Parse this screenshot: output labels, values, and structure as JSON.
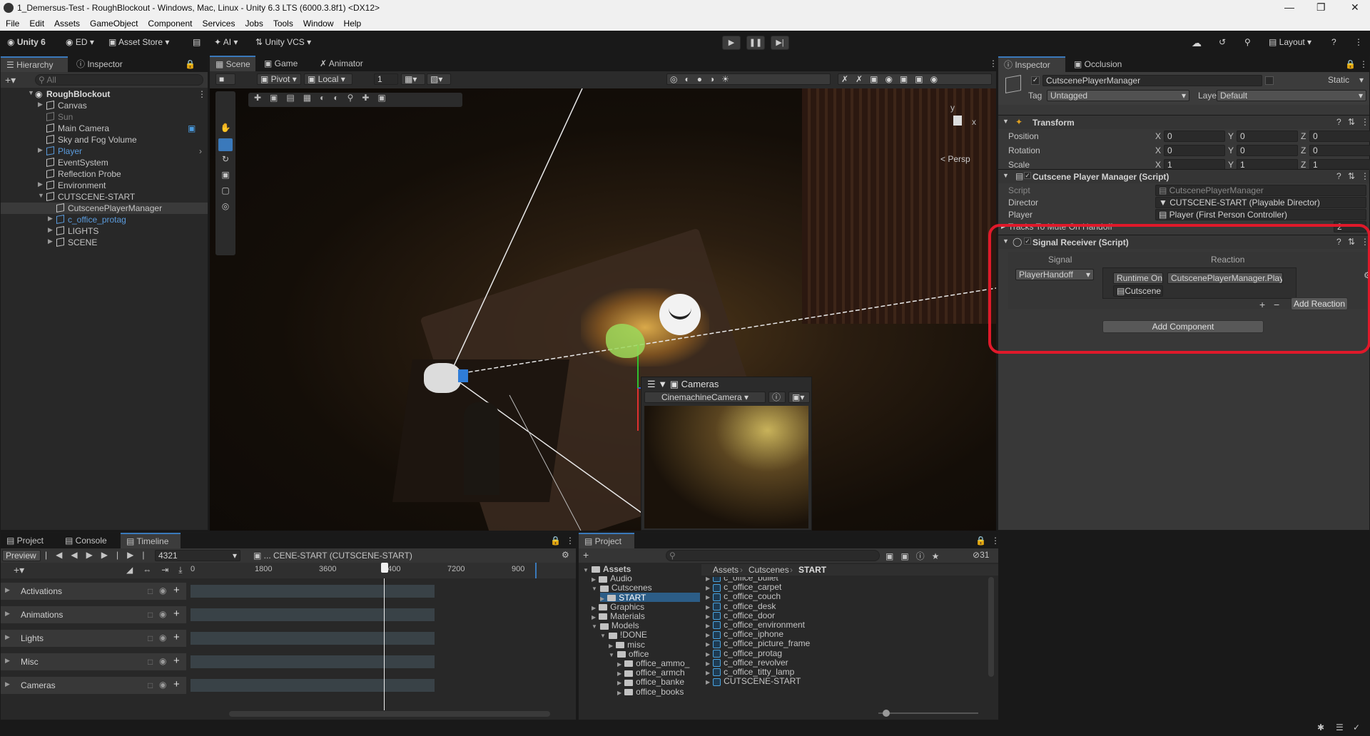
{
  "window": {
    "title": "1_Demersus-Test - RoughBlockout - Windows, Mac, Linux - Unity 6.3 LTS (6000.3.8f1) <DX12>"
  },
  "menu": [
    "File",
    "Edit",
    "Assets",
    "GameObject",
    "Component",
    "Services",
    "Jobs",
    "Tools",
    "Window",
    "Help"
  ],
  "toolbar": {
    "unity": "Unity 6",
    "account": "ED",
    "asset_store": "Asset Store",
    "ai": "AI",
    "vcs": "Unity VCS",
    "layout": "Layout"
  },
  "hierarchy": {
    "tabs": [
      "Hierarchy",
      "Inspector"
    ],
    "search_placeholder": "All",
    "root": "RoughBlockout",
    "items": [
      {
        "label": "Canvas",
        "indent": 1,
        "color": "#c4c4c4"
      },
      {
        "label": "Sun",
        "indent": 1,
        "color": "#7a7a7a"
      },
      {
        "label": "Main Camera",
        "indent": 1,
        "color": "#c4c4c4"
      },
      {
        "label": "Sky and Fog Volume",
        "indent": 1,
        "color": "#c4c4c4"
      },
      {
        "label": "Player",
        "indent": 1,
        "color": "#5b9bdc"
      },
      {
        "label": "EventSystem",
        "indent": 1,
        "color": "#c4c4c4"
      },
      {
        "label": "Reflection Probe",
        "indent": 1,
        "color": "#c4c4c4"
      },
      {
        "label": "Environment",
        "indent": 1,
        "color": "#c4c4c4"
      },
      {
        "label": "CUTSCENE-START",
        "indent": 1,
        "color": "#c4c4c4"
      },
      {
        "label": "CutscenePlayerManager",
        "indent": 2,
        "color": "#c4c4c4"
      },
      {
        "label": "c_office_protag",
        "indent": 2,
        "color": "#5b9bdc"
      },
      {
        "label": "LIGHTS",
        "indent": 2,
        "color": "#c4c4c4"
      },
      {
        "label": "SCENE",
        "indent": 2,
        "color": "#c4c4c4"
      }
    ]
  },
  "scene": {
    "tabs": [
      "Scene",
      "Game",
      "Animator"
    ],
    "pivot": "Pivot",
    "local": "Local",
    "grid_value": "1",
    "persp": "< Persp",
    "cameras_overlay": {
      "title": "Cameras",
      "camera": "CinemachineCamera"
    }
  },
  "inspector": {
    "tabs": [
      "Inspector",
      "Occlusion"
    ],
    "object_name": "CutscenePlayerManager",
    "static": "Static",
    "tag_label": "Tag",
    "tag": "Untagged",
    "layer_label": "Layer",
    "layer": "Default",
    "transform": {
      "title": "Transform",
      "position": {
        "label": "Position",
        "x": "0",
        "y": "0",
        "z": "0"
      },
      "rotation": {
        "label": "Rotation",
        "x": "0",
        "y": "0",
        "z": "0"
      },
      "scale": {
        "label": "Scale",
        "x": "1",
        "y": "1",
        "z": "1"
      }
    },
    "cpm": {
      "title": "Cutscene Player Manager (Script)",
      "script_label": "Script",
      "script": "CutscenePlayerManager",
      "director_label": "Director",
      "director": "CUTSCENE-START (Playable Director)",
      "player_label": "Player",
      "player": "Player (First Person Controller)",
      "tracks_label": "Tracks To Mute On Handoff",
      "tracks": "2"
    },
    "signal": {
      "title": "Signal Receiver (Script)",
      "col_signal": "Signal",
      "col_reaction": "Reaction",
      "signal_value": "PlayerHandoff",
      "runtime": "Runtime Onl",
      "method": "CutscenePlayerManager.PlayerH",
      "object": "Cutscene",
      "add_reaction": "Add Reaction"
    },
    "add_component": "Add Component"
  },
  "timeline": {
    "tabs": [
      "Project",
      "Console",
      "Timeline"
    ],
    "preview": "Preview",
    "frame": "4321",
    "director": "... CENE-START (CUTSCENE-START)",
    "ruler": [
      "0",
      "1800",
      "3600",
      "5400",
      "7200",
      "900"
    ],
    "tracks": [
      "Activations",
      "Animations",
      "Lights",
      "Misc",
      "Cameras"
    ]
  },
  "project": {
    "tab": "Project",
    "count": "31",
    "breadcrumb": [
      "Assets",
      "Cutscenes",
      "START"
    ],
    "tree": [
      {
        "label": "Assets",
        "indent": 0,
        "bold": true
      },
      {
        "label": "Audio",
        "indent": 1
      },
      {
        "label": "Cutscenes",
        "indent": 1
      },
      {
        "label": "START",
        "indent": 2,
        "selected": true
      },
      {
        "label": "Graphics",
        "indent": 1
      },
      {
        "label": "Materials",
        "indent": 1
      },
      {
        "label": "Models",
        "indent": 1
      },
      {
        "label": "!DONE",
        "indent": 2
      },
      {
        "label": "misc",
        "indent": 3
      },
      {
        "label": "office",
        "indent": 3
      },
      {
        "label": "office_ammo_",
        "indent": 4
      },
      {
        "label": "office_armch",
        "indent": 4
      },
      {
        "label": "office_banke",
        "indent": 4
      },
      {
        "label": "office_books",
        "indent": 4
      }
    ],
    "files": [
      "c_office_bullet",
      "c_office_carpet",
      "c_office_couch",
      "c_office_desk",
      "c_office_door",
      "c_office_environment",
      "c_office_iphone",
      "c_office_picture_frame",
      "c_office_protag",
      "c_office_revolver",
      "c_office_titty_lamp",
      "CUTSCENE-START"
    ]
  },
  "colors": {
    "accent": "#3a79bb",
    "highlight": "#e0192a"
  }
}
